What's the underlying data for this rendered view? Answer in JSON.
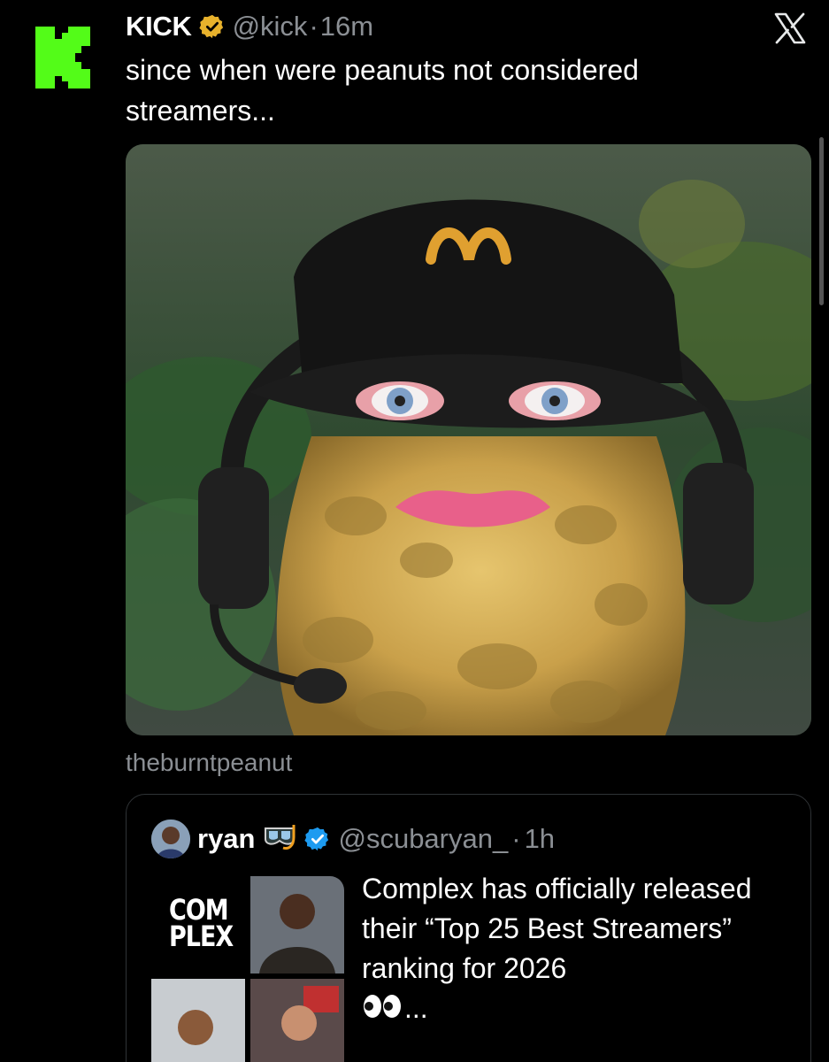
{
  "tweet": {
    "display_name": "KICK",
    "handle": "@kick",
    "separator": "·",
    "time": "16m",
    "text": "since when were peanuts not considered streamers...",
    "media_caption": "theburntpeanut"
  },
  "quote": {
    "display_name": "ryan",
    "handle": "@scubaryan_",
    "separator": "·",
    "time": "1h",
    "text": "Complex has officially released their “Top 25 Best Streamers” ranking for 2026",
    "text_suffix": "...",
    "complex_logo_top": "COM",
    "complex_logo_bottom": "PLEX"
  },
  "icons": {
    "kick_logo": "kick-logo-icon",
    "verified_gold": "verified-gold-icon",
    "verified_blue": "verified-blue-icon",
    "x_logo": "x-logo-icon",
    "diving_mask": "diving-mask-icon",
    "eyes": "eyes-icon"
  },
  "colors": {
    "background": "#000000",
    "kick_green": "#53fc18",
    "text_primary": "#ffffff",
    "text_secondary": "#8b8f94",
    "verified_gold": "#e8b22c",
    "verified_blue": "#1d9bf0",
    "border": "#2f3336"
  }
}
